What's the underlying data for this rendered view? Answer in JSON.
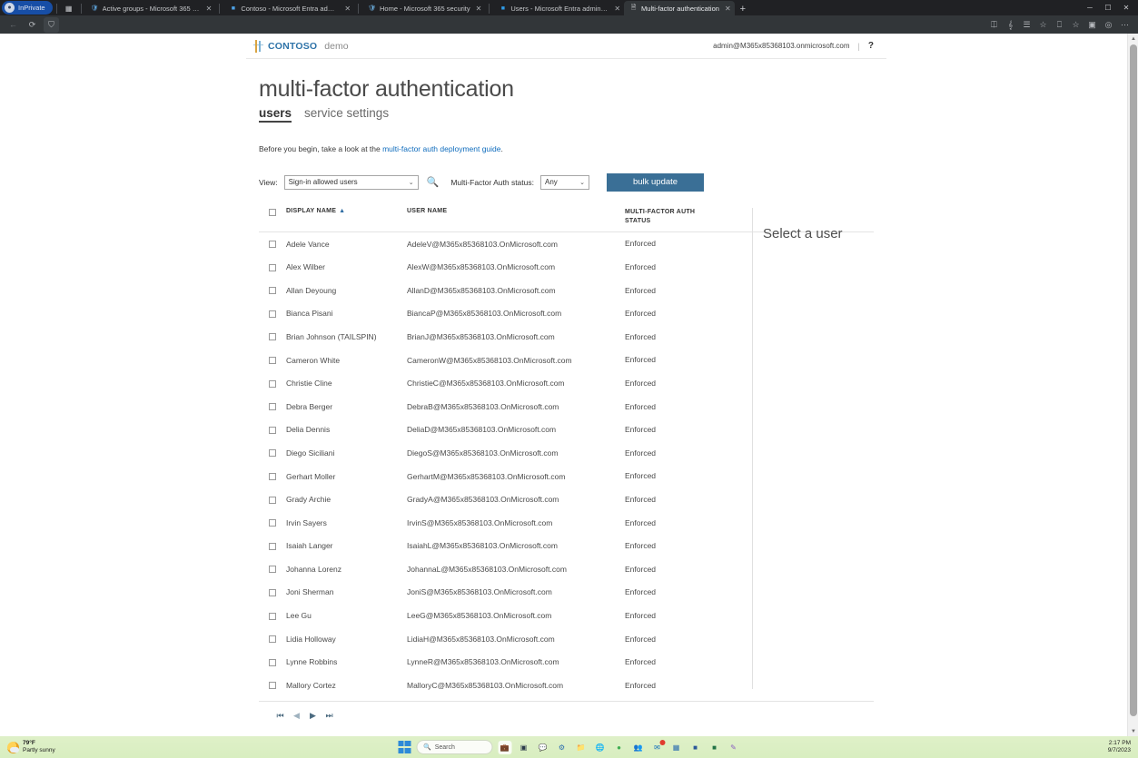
{
  "browser": {
    "inprivate_label": "InPrivate",
    "tabs": [
      {
        "label": "Active groups - Microsoft 365 a...",
        "favicon": "shield-icon",
        "active": false
      },
      {
        "label": "Contoso - Microsoft Entra admin...",
        "favicon": "entra-icon",
        "active": false
      },
      {
        "label": "Home - Microsoft 365 security",
        "favicon": "security-icon",
        "active": false
      },
      {
        "label": "Users - Microsoft Entra admin ce...",
        "favicon": "users-icon",
        "active": false
      },
      {
        "label": "Multi-factor authentication",
        "favicon": "page-icon",
        "active": true
      }
    ],
    "new_tab_label": "+",
    "close_label": "✕",
    "nav": {
      "back": "←",
      "refresh": "⟳",
      "shield": "⛉",
      "right_icons": [
        "share-icon",
        "collections-read-icon",
        "split-screen-icon",
        "favorite-icon",
        "workspaces-icon",
        "browser-essentials-icon",
        "more-icon"
      ]
    },
    "window_controls": {
      "minimize": "─",
      "maximize": "☐",
      "close": "✕"
    }
  },
  "suitebar": {
    "brand_name": "CONTOSO",
    "brand_sub": "demo",
    "account": "admin@M365x85368103.onmicrosoft.com",
    "separator": "|",
    "help": "?"
  },
  "page": {
    "title": "multi-factor authentication",
    "pivots": [
      {
        "label": "users",
        "selected": true
      },
      {
        "label": "service settings",
        "selected": false
      }
    ],
    "help_prefix": "Before you begin, take a look at the ",
    "help_link": "multi-factor auth deployment guide",
    "help_suffix": "."
  },
  "filters": {
    "view_label": "View:",
    "view_value": "Sign-in allowed users",
    "search_icon": "search-icon",
    "status_label": "Multi-Factor Auth status:",
    "status_value": "Any",
    "bulk_update_label": "bulk update",
    "caret": "⌄"
  },
  "table": {
    "columns": {
      "display_name": "DISPLAY NAME",
      "sort_caret": "▲",
      "user_name": "USER NAME",
      "status_line1": "MULTI-FACTOR AUTH",
      "status_line2": "STATUS"
    },
    "rows": [
      {
        "display_name": "Adele Vance",
        "user_name": "AdeleV@M365x85368103.OnMicrosoft.com",
        "status": "Enforced"
      },
      {
        "display_name": "Alex Wilber",
        "user_name": "AlexW@M365x85368103.OnMicrosoft.com",
        "status": "Enforced"
      },
      {
        "display_name": "Allan Deyoung",
        "user_name": "AllanD@M365x85368103.OnMicrosoft.com",
        "status": "Enforced"
      },
      {
        "display_name": "Bianca Pisani",
        "user_name": "BiancaP@M365x85368103.OnMicrosoft.com",
        "status": "Enforced"
      },
      {
        "display_name": "Brian Johnson (TAILSPIN)",
        "user_name": "BrianJ@M365x85368103.OnMicrosoft.com",
        "status": "Enforced"
      },
      {
        "display_name": "Cameron White",
        "user_name": "CameronW@M365x85368103.OnMicrosoft.com",
        "status": "Enforced"
      },
      {
        "display_name": "Christie Cline",
        "user_name": "ChristieC@M365x85368103.OnMicrosoft.com",
        "status": "Enforced"
      },
      {
        "display_name": "Debra Berger",
        "user_name": "DebraB@M365x85368103.OnMicrosoft.com",
        "status": "Enforced"
      },
      {
        "display_name": "Delia Dennis",
        "user_name": "DeliaD@M365x85368103.OnMicrosoft.com",
        "status": "Enforced"
      },
      {
        "display_name": "Diego Siciliani",
        "user_name": "DiegoS@M365x85368103.OnMicrosoft.com",
        "status": "Enforced"
      },
      {
        "display_name": "Gerhart Moller",
        "user_name": "GerhartM@M365x85368103.OnMicrosoft.com",
        "status": "Enforced"
      },
      {
        "display_name": "Grady Archie",
        "user_name": "GradyA@M365x85368103.OnMicrosoft.com",
        "status": "Enforced"
      },
      {
        "display_name": "Irvin Sayers",
        "user_name": "IrvinS@M365x85368103.OnMicrosoft.com",
        "status": "Enforced"
      },
      {
        "display_name": "Isaiah Langer",
        "user_name": "IsaiahL@M365x85368103.OnMicrosoft.com",
        "status": "Enforced"
      },
      {
        "display_name": "Johanna Lorenz",
        "user_name": "JohannaL@M365x85368103.OnMicrosoft.com",
        "status": "Enforced"
      },
      {
        "display_name": "Joni Sherman",
        "user_name": "JoniS@M365x85368103.OnMicrosoft.com",
        "status": "Enforced"
      },
      {
        "display_name": "Lee Gu",
        "user_name": "LeeG@M365x85368103.OnMicrosoft.com",
        "status": "Enforced"
      },
      {
        "display_name": "Lidia Holloway",
        "user_name": "LidiaH@M365x85368103.OnMicrosoft.com",
        "status": "Enforced"
      },
      {
        "display_name": "Lynne Robbins",
        "user_name": "LynneR@M365x85368103.OnMicrosoft.com",
        "status": "Enforced"
      },
      {
        "display_name": "Mallory Cortez",
        "user_name": "MalloryC@M365x85368103.OnMicrosoft.com",
        "status": "Enforced"
      }
    ],
    "pagination": {
      "first": "⏮",
      "prev": "◀",
      "next": "▶",
      "last": "⏭"
    }
  },
  "detail": {
    "empty_title": "Select a user"
  },
  "taskbar": {
    "weather_temp": "79°F",
    "weather_desc": "Partly sunny",
    "search_placeholder": "Search",
    "clock_time": "2:17 PM",
    "clock_date": "9/7/2023",
    "apps": [
      "file-explorer-icon",
      "store-icon",
      "chat-icon",
      "settings-icon",
      "explorer-folder-icon",
      "edge-icon",
      "chrome-icon",
      "teams-icon",
      "outlook-icon",
      "store-app-icon",
      "word-icon",
      "excel-icon",
      "paint-icon"
    ]
  },
  "colors": {
    "accent_blue": "#3a6f96",
    "link_blue": "#0f6cbd",
    "brand_blue": "#2e73a8"
  }
}
